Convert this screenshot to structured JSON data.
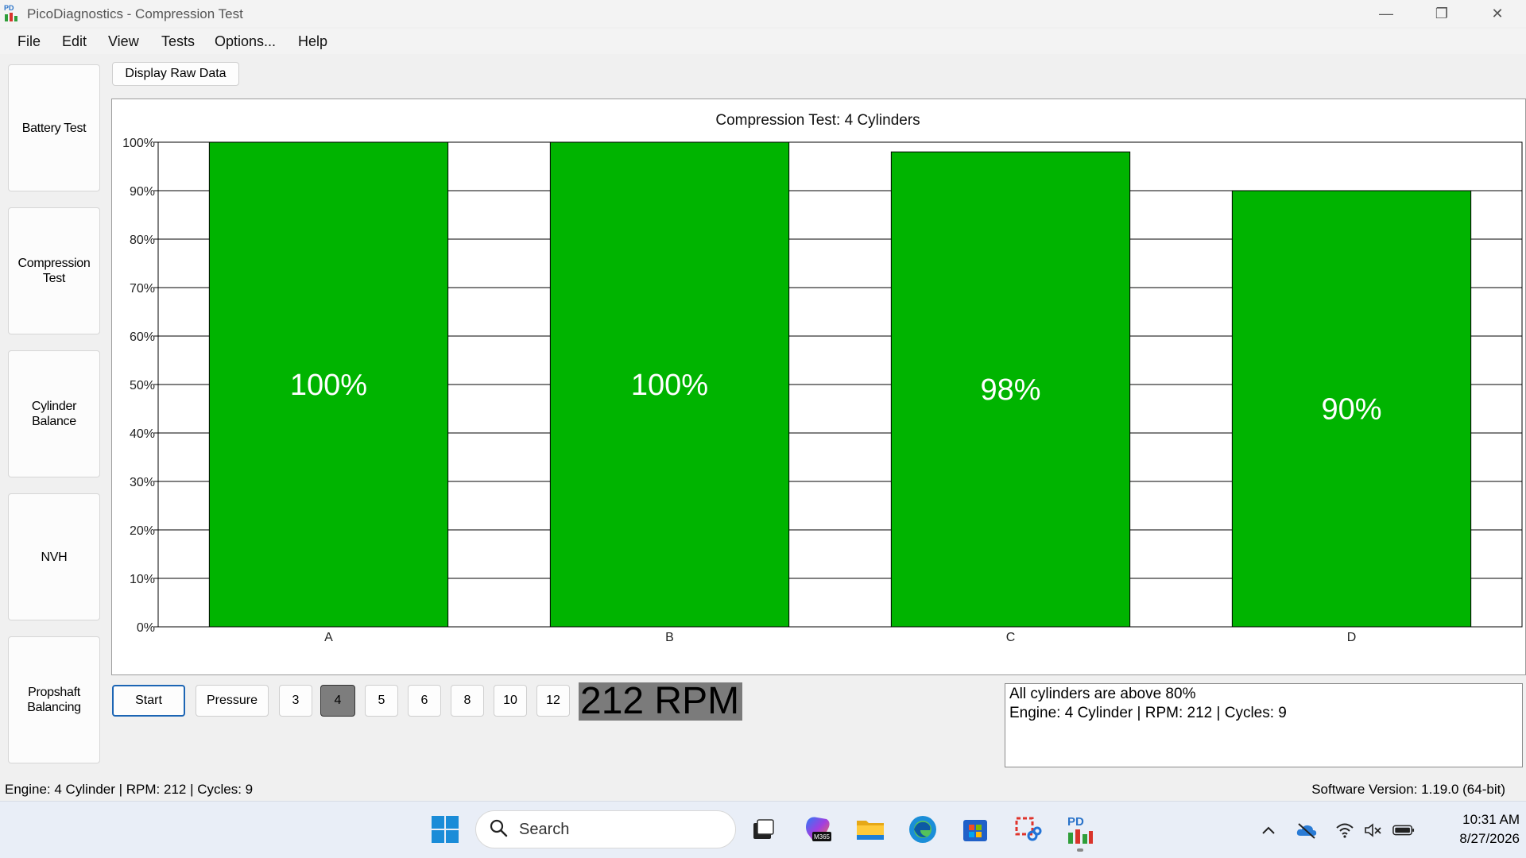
{
  "window": {
    "title": "PicoDiagnostics - Compression Test",
    "minimize_glyph": "—",
    "maximize_glyph": "❐",
    "close_glyph": "✕"
  },
  "menu": [
    "File",
    "Edit",
    "View",
    "Tests",
    "Options...",
    "Help"
  ],
  "sidebar": [
    {
      "label": "Battery Test"
    },
    {
      "label": "Compression\nTest"
    },
    {
      "label": "Cylinder\nBalance"
    },
    {
      "label": "NVH"
    },
    {
      "label": "Propshaft\nBalancing"
    }
  ],
  "toolbar": {
    "raw_data_label": "Display Raw Data"
  },
  "chart_data": {
    "type": "bar",
    "title": "Compression Test: 4 Cylinders",
    "categories": [
      "A",
      "B",
      "C",
      "D"
    ],
    "values": [
      100,
      100,
      98,
      90
    ],
    "value_labels": [
      "100%",
      "100%",
      "98%",
      "90%"
    ],
    "ylim": [
      0,
      100
    ],
    "yticks": [
      "0%",
      "10%",
      "20%",
      "30%",
      "40%",
      "50%",
      "60%",
      "70%",
      "80%",
      "90%",
      "100%"
    ],
    "bar_color": "#00b400",
    "grid": true,
    "xlabel": "",
    "ylabel": ""
  },
  "controls": {
    "start_label": "Start",
    "pressure_label": "Pressure",
    "cylinder_options": [
      "3",
      "4",
      "5",
      "6",
      "8",
      "10",
      "12"
    ],
    "selected_cylinders": "4",
    "rpm_display": "212 RPM"
  },
  "result": {
    "line1": "All cylinders are above 80%",
    "line2": "Engine: 4 Cylinder | RPM: 212 | Cycles: 9"
  },
  "status": {
    "left": "Engine: 4 Cylinder | RPM: 212 | Cycles: 9",
    "right": "Software Version: 1.19.0 (64-bit)"
  },
  "taskbar": {
    "search_placeholder": "Search",
    "copilot_badge": "M365",
    "pd_icon_text": "PD",
    "time": "10:31 AM",
    "date": "8/27/2026"
  },
  "colors": {
    "accent": "#1c65b4",
    "bar": "#00b400"
  }
}
